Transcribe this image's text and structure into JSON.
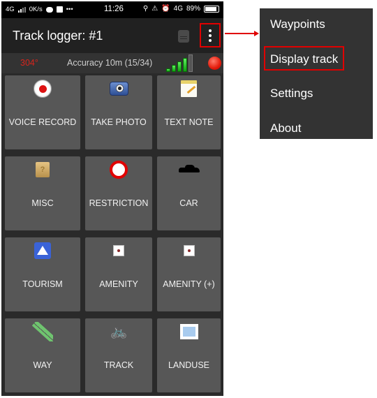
{
  "status_bar": {
    "network": "4G",
    "speed": "0K/s",
    "more": "•••",
    "time": "11:26",
    "net_right": "4G",
    "battery": "89%",
    "battery_level": 0.89
  },
  "app_bar": {
    "title": "Track logger: #1",
    "doc_icon": "document-icon",
    "overflow_icon": "more-vert-icon"
  },
  "info_bar": {
    "heading": "304°",
    "accuracy": "Accuracy 10m (15/34)",
    "gps_signal_bars_active": 4,
    "gps_signal_bars_total": 5,
    "colors": {
      "heading": "#d8241c",
      "signal": "#22c022",
      "record": "#e31b0b"
    }
  },
  "tiles": [
    {
      "label": "VOICE RECORD",
      "icon": "record-icon"
    },
    {
      "label": "TAKE PHOTO",
      "icon": "camera-icon"
    },
    {
      "label": "TEXT NOTE",
      "icon": "note-icon"
    },
    {
      "label": "MISC",
      "icon": "box-icon"
    },
    {
      "label": "RESTRICTION",
      "icon": "restriction-icon"
    },
    {
      "label": "CAR",
      "icon": "car-icon"
    },
    {
      "label": "TOURISM",
      "icon": "tent-icon"
    },
    {
      "label": "AMENITY",
      "icon": "amenity-icon"
    },
    {
      "label": "AMENITY (+)",
      "icon": "amenity-icon"
    },
    {
      "label": "WAY",
      "icon": "way-icon"
    },
    {
      "label": "TRACK",
      "icon": "bicycle-icon"
    },
    {
      "label": "LANDUSE",
      "icon": "landuse-icon"
    }
  ],
  "overflow_menu": {
    "items": [
      {
        "label": "Waypoints"
      },
      {
        "label": "Display track",
        "highlighted": true
      },
      {
        "label": "Settings"
      },
      {
        "label": "About"
      }
    ]
  },
  "annotation": {
    "highlight_color": "#e00000"
  }
}
